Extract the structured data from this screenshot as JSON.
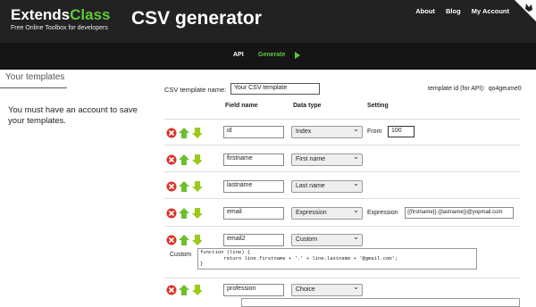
{
  "header": {
    "logo_part1": "Extends",
    "logo_part2": "Class",
    "tagline": "Free Online Toolbox for developers",
    "app_title": "CSV generator",
    "nav": [
      "About",
      "Blog",
      "My Account"
    ]
  },
  "subnav": {
    "api": "API",
    "generate": "Generate"
  },
  "sidebar": {
    "title": "Your templates",
    "message": "You must have an account to save your templates."
  },
  "template": {
    "name_label": "CSV template name:",
    "name_value": "Your CSV template",
    "id_label": "template id (for API):",
    "id_value": "qo4geume0"
  },
  "columns": {
    "field": "Field name",
    "type": "Data type",
    "setting": "Setting"
  },
  "rows": [
    {
      "field": "id",
      "type": "Index",
      "setting_label": "From",
      "setting_value": "100"
    },
    {
      "field": "firstname",
      "type": "First name"
    },
    {
      "field": "lastname",
      "type": "Last name"
    },
    {
      "field": "email",
      "type": "Expression",
      "setting_label": "Expression",
      "setting_value": "{{firstname}}.{{lastname}}@yopmail.com"
    },
    {
      "field": "email2",
      "type": "Custom",
      "custom_label": "Custom",
      "custom_code": [
        "function (line) {",
        "        return line.firstname + '.' + line.lastname + '@gmail.com';",
        "}"
      ]
    },
    {
      "field": "profession",
      "type": "Choice"
    }
  ],
  "colors": {
    "accent": "#5fc93a",
    "header_bg": "#222222",
    "subbar_bg": "#151515",
    "delete": "#d9342b",
    "up": "#6cbf2e",
    "down": "#9acb1a"
  }
}
